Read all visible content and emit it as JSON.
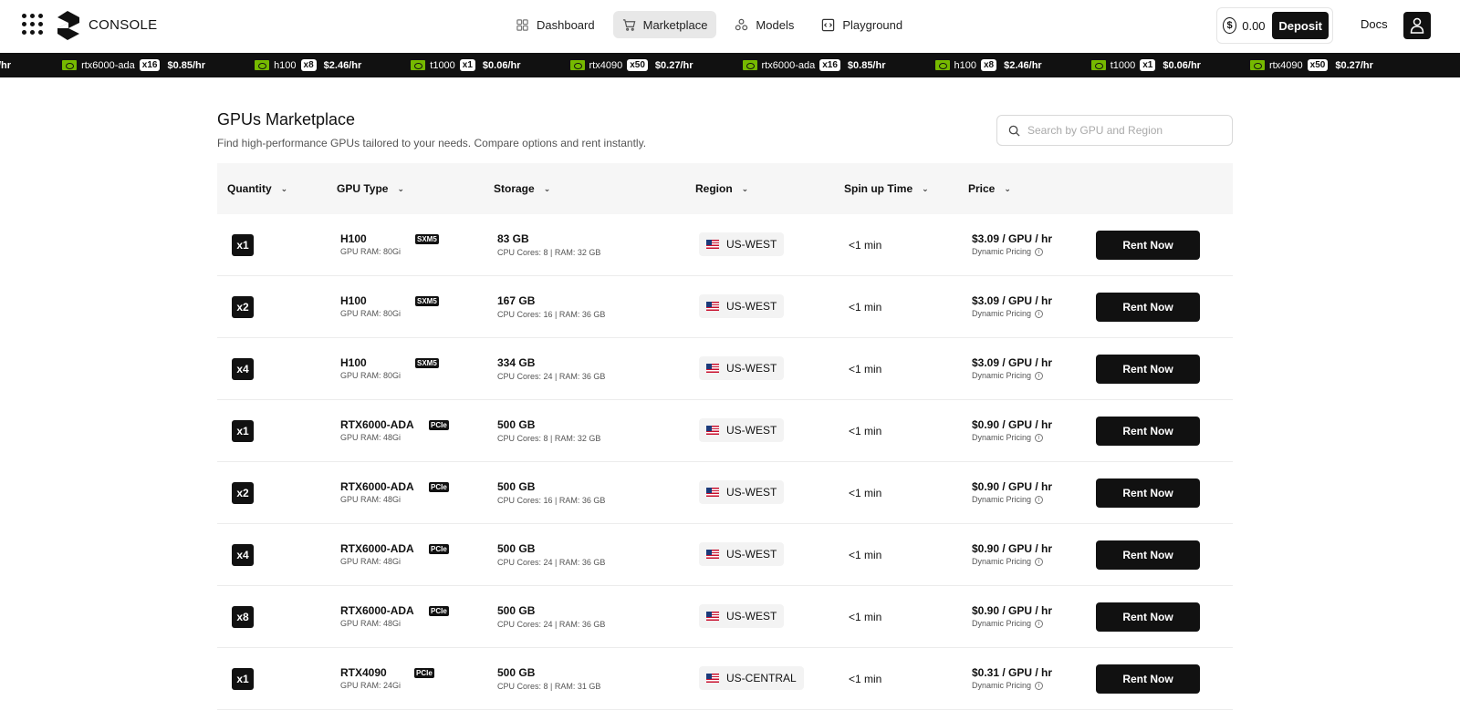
{
  "header": {
    "brand": "CONSOLE",
    "nav": [
      {
        "label": "Dashboard",
        "icon": "dashboard-icon"
      },
      {
        "label": "Marketplace",
        "icon": "cart-icon",
        "active": true
      },
      {
        "label": "Models",
        "icon": "models-icon"
      },
      {
        "label": "Playground",
        "icon": "code-window-icon"
      }
    ],
    "balance": "0.00",
    "deposit_label": "Deposit",
    "docs_label": "Docs"
  },
  "ticker": {
    "lead_text": "/hr",
    "items": [
      {
        "name": "rtx6000-ada",
        "qty": "x16",
        "price": "$0.85/hr"
      },
      {
        "name": "h100",
        "qty": "x8",
        "price": "$2.46/hr"
      },
      {
        "name": "t1000",
        "qty": "x1",
        "price": "$0.06/hr"
      },
      {
        "name": "rtx4090",
        "qty": "x50",
        "price": "$0.27/hr"
      },
      {
        "name": "rtx6000-ada",
        "qty": "x16",
        "price": "$0.85/hr"
      },
      {
        "name": "h100",
        "qty": "x8",
        "price": "$2.46/hr"
      },
      {
        "name": "t1000",
        "qty": "x1",
        "price": "$0.06/hr"
      },
      {
        "name": "rtx4090",
        "qty": "x50",
        "price": "$0.27/hr"
      }
    ]
  },
  "main": {
    "title": "GPUs Marketplace",
    "subtitle": "Find high-performance GPUs tailored to your needs. Compare options and rent instantly.",
    "search_placeholder": "Search by GPU and Region"
  },
  "table": {
    "columns": [
      "Quantity",
      "GPU Type",
      "Storage",
      "Region",
      "Spin up Time",
      "Price"
    ],
    "rows": [
      {
        "qty": "x1",
        "gpu": "H100",
        "ram": "GPU RAM: 80Gi",
        "form": "SXM5",
        "storage": "83 GB",
        "cpu": "CPU Cores: 8 | RAM: 32 GB",
        "region": "US-WEST",
        "spin": "<1 min",
        "price": "$3.09 / GPU / hr",
        "pricing": "Dynamic Pricing",
        "action": "Rent Now"
      },
      {
        "qty": "x2",
        "gpu": "H100",
        "ram": "GPU RAM: 80Gi",
        "form": "SXM5",
        "storage": "167 GB",
        "cpu": "CPU Cores: 16 | RAM: 36 GB",
        "region": "US-WEST",
        "spin": "<1 min",
        "price": "$3.09 / GPU / hr",
        "pricing": "Dynamic Pricing",
        "action": "Rent Now"
      },
      {
        "qty": "x4",
        "gpu": "H100",
        "ram": "GPU RAM: 80Gi",
        "form": "SXM5",
        "storage": "334 GB",
        "cpu": "CPU Cores: 24 | RAM: 36 GB",
        "region": "US-WEST",
        "spin": "<1 min",
        "price": "$3.09 / GPU / hr",
        "pricing": "Dynamic Pricing",
        "action": "Rent Now"
      },
      {
        "qty": "x1",
        "gpu": "RTX6000-ADA",
        "ram": "GPU RAM: 48Gi",
        "form": "PCIe",
        "storage": "500 GB",
        "cpu": "CPU Cores: 8 | RAM: 32 GB",
        "region": "US-WEST",
        "spin": "<1 min",
        "price": "$0.90 / GPU / hr",
        "pricing": "Dynamic Pricing",
        "action": "Rent Now"
      },
      {
        "qty": "x2",
        "gpu": "RTX6000-ADA",
        "ram": "GPU RAM: 48Gi",
        "form": "PCIe",
        "storage": "500 GB",
        "cpu": "CPU Cores: 16 | RAM: 36 GB",
        "region": "US-WEST",
        "spin": "<1 min",
        "price": "$0.90 / GPU / hr",
        "pricing": "Dynamic Pricing",
        "action": "Rent Now"
      },
      {
        "qty": "x4",
        "gpu": "RTX6000-ADA",
        "ram": "GPU RAM: 48Gi",
        "form": "PCIe",
        "storage": "500 GB",
        "cpu": "CPU Cores: 24 | RAM: 36 GB",
        "region": "US-WEST",
        "spin": "<1 min",
        "price": "$0.90 / GPU / hr",
        "pricing": "Dynamic Pricing",
        "action": "Rent Now"
      },
      {
        "qty": "x8",
        "gpu": "RTX6000-ADA",
        "ram": "GPU RAM: 48Gi",
        "form": "PCIe",
        "storage": "500 GB",
        "cpu": "CPU Cores: 24 | RAM: 36 GB",
        "region": "US-WEST",
        "spin": "<1 min",
        "price": "$0.90 / GPU / hr",
        "pricing": "Dynamic Pricing",
        "action": "Rent Now"
      },
      {
        "qty": "x1",
        "gpu": "RTX4090",
        "ram": "GPU RAM: 24Gi",
        "form": "PCIe",
        "storage": "500 GB",
        "cpu": "CPU Cores: 8 | RAM: 31 GB",
        "region": "US-CENTRAL",
        "spin": "<1 min",
        "price": "$0.31 / GPU / hr",
        "pricing": "Dynamic Pricing",
        "action": "Rent Now"
      }
    ]
  },
  "colors": {
    "accent": "#111111",
    "nvidia": "#76b900",
    "header_bg": "#f6f6f6"
  }
}
